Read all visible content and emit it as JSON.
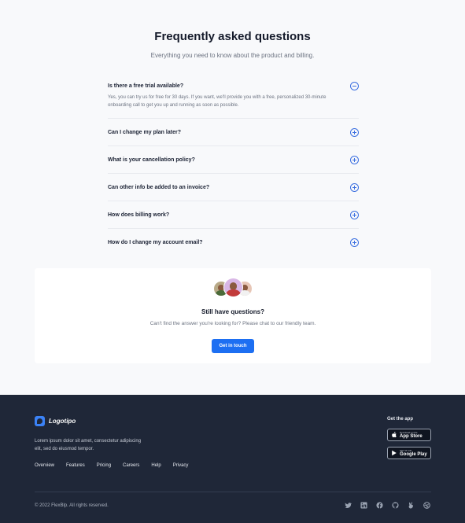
{
  "faq": {
    "title": "Frequently asked questions",
    "subtitle": "Everything you need to know about the product and billing.",
    "items": [
      {
        "question": "Is there a free trial available?",
        "answer": "Yes, you can try us for free for 30 days. If you want, we'll provide you with a free, personalized 30-minute onboarding call to get you up and running as soon as possible.",
        "expanded": true
      },
      {
        "question": "Can I change my plan later?",
        "expanded": false
      },
      {
        "question": "What is your cancellation policy?",
        "expanded": false
      },
      {
        "question": "Can other info be added to an invoice?",
        "expanded": false
      },
      {
        "question": "How does billing work?",
        "expanded": false
      },
      {
        "question": "How do I change my account email?",
        "expanded": false
      }
    ]
  },
  "help": {
    "title": "Still have questions?",
    "text": "Can't find the answer you're looking for? Please chat to our friendly team.",
    "button": "Get in touch"
  },
  "footer": {
    "logo": "Logotipo",
    "description": "Lorem ipsum dolor sit amet, consectetur adipiscing elit, sed do eiusmod tempor.",
    "nav": [
      "Overview",
      "Features",
      "Pricing",
      "Careers",
      "Help",
      "Privacy"
    ],
    "get_app": "Get the app",
    "app_store": {
      "small": "Download on the",
      "big": "App Store"
    },
    "google_play": {
      "small": "GET IT ON",
      "big": "Google Play"
    },
    "copyright": "© 2022 FlexBlp. All rights reserved.",
    "socials": [
      "twitter-icon",
      "linkedin-icon",
      "facebook-icon",
      "github-icon",
      "angellist-icon",
      "dribbble-icon"
    ]
  },
  "colors": {
    "accent": "#1d6ff2",
    "footer_bg": "#1f2738",
    "page_bg": "#f8f9fb"
  }
}
